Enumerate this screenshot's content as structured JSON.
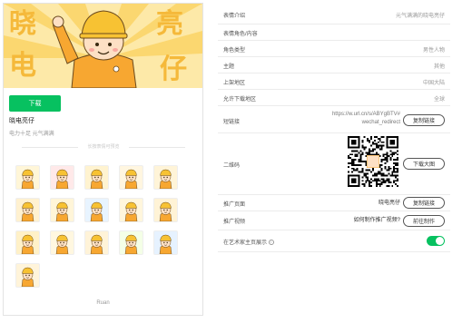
{
  "banner": {
    "chars": [
      "晓",
      "电",
      "亮",
      "仔"
    ],
    "colors": {
      "bg": "#fde9a8",
      "ray": "#fbd66a",
      "text": "#f5b93a",
      "suit": "#f7a731",
      "helmet": "#f7c233"
    }
  },
  "pack": {
    "download_label": "下载",
    "name": "晓电亮仔",
    "description": "电力十足 元气满满",
    "section_label": "长按表情可预览",
    "author": "Ruan"
  },
  "stickers": [
    {
      "name": "sticker-1",
      "bg": "#fff6d8",
      "icon": "character-hello"
    },
    {
      "name": "sticker-2",
      "bg": "#ffe9e9",
      "icon": "character-love"
    },
    {
      "name": "sticker-3",
      "bg": "#fff3d0",
      "icon": "character-ok"
    },
    {
      "name": "sticker-4",
      "bg": "#fff6e0",
      "icon": "character-cheer"
    },
    {
      "name": "sticker-5",
      "bg": "#fff4d8",
      "icon": "character-thumbs"
    },
    {
      "name": "sticker-6",
      "bg": "#fff1d0",
      "icon": "character-think"
    },
    {
      "name": "sticker-7",
      "bg": "#fff5d8",
      "icon": "character-smile"
    },
    {
      "name": "sticker-8",
      "bg": "#e8f4ff",
      "icon": "character-cry"
    },
    {
      "name": "sticker-9",
      "bg": "#fff6dc",
      "icon": "character-wave"
    },
    {
      "name": "sticker-10",
      "bg": "#fff3d6",
      "icon": "character-bow"
    },
    {
      "name": "sticker-11",
      "bg": "#fff1c8",
      "icon": "character-flag"
    },
    {
      "name": "sticker-12",
      "bg": "#fff7e0",
      "icon": "character-run"
    },
    {
      "name": "sticker-13",
      "bg": "#fff3d8",
      "icon": "character-sleep"
    },
    {
      "name": "sticker-14",
      "bg": "#f4ffe6",
      "icon": "character-happy"
    },
    {
      "name": "sticker-15",
      "bg": "#e6f2ff",
      "icon": "character-question"
    },
    {
      "name": "sticker-16",
      "bg": "#fff4da",
      "icon": "character-bye"
    }
  ],
  "info": {
    "intro_label": "表情介绍",
    "intro_value": "元气满满的晓电亮仔",
    "role_label": "表情角色/内容",
    "role_type_label": "角色类型",
    "role_type_value": "男性人物",
    "theme_label": "主题",
    "theme_value": "其他",
    "region_label": "上架地区",
    "region_value": "中国大陆",
    "download_region_label": "允许下载地区",
    "download_region_value": "全球",
    "short_link_label": "短链接",
    "short_link_value_line1": "https://w.url.cn/s/ABYgBTV#",
    "short_link_value_line2": "wechat_redirect",
    "copy_link_label": "复制链接",
    "qr_label": "二维码",
    "download_qr_label": "下载大图",
    "promo_page_label": "推广页面",
    "promo_page_value": "晓电亮仔",
    "promo_copy_label": "复制链接",
    "promo_video_label": "推广视频",
    "promo_video_value": "如何制作推广视频?",
    "go_make_label": "前往制作",
    "show_home_label": "在艺术家主页展示",
    "show_home_info_icon": "i",
    "show_home_enabled": true
  }
}
